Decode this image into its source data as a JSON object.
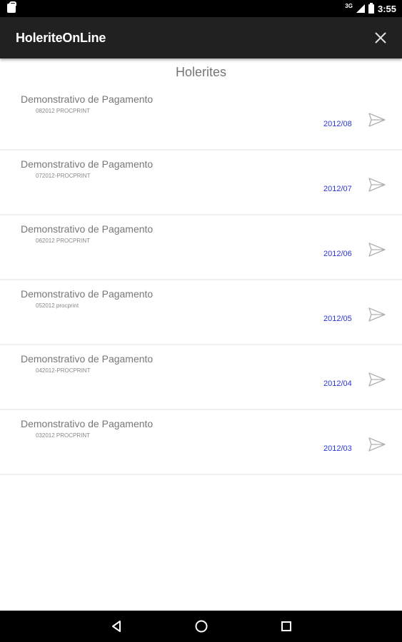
{
  "status_bar": {
    "network_label": "3G",
    "time": "3:55"
  },
  "app_bar": {
    "title": "HoleriteOnLine",
    "close_icon": "close-icon"
  },
  "page": {
    "title": "Holerites"
  },
  "items": [
    {
      "title": "Demonstrativo de Pagamento",
      "subtitle": "082012 PROCPRINT",
      "date": "2012/08"
    },
    {
      "title": "Demonstrativo de Pagamento",
      "subtitle": "072012-PROCPRINT",
      "date": "2012/07"
    },
    {
      "title": "Demonstrativo de Pagamento",
      "subtitle": "062012 PROCPRINT",
      "date": "2012/06"
    },
    {
      "title": "Demonstrativo de Pagamento",
      "subtitle": "052012 procprint",
      "date": "2012/05"
    },
    {
      "title": "Demonstrativo de Pagamento",
      "subtitle": "042012-PROCPRINT",
      "date": "2012/04"
    },
    {
      "title": "Demonstrativo de Pagamento",
      "subtitle": "032012 PROCPRINT",
      "date": "2012/03"
    }
  ],
  "nav_bar": {
    "back_icon": "back-triangle-icon",
    "home_icon": "home-circle-icon",
    "recents_icon": "recents-square-icon"
  },
  "colors": {
    "app_bar": "#212121",
    "date_text": "#2a35d6",
    "title_text": "#777777"
  }
}
